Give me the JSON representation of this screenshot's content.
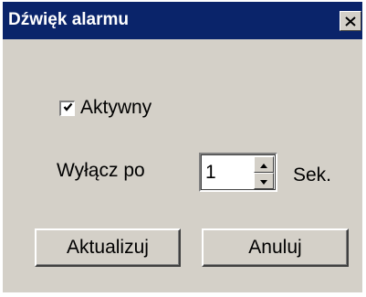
{
  "window": {
    "title": "Dźwięk alarmu",
    "close_icon": "close-icon"
  },
  "form": {
    "active_checkbox": {
      "label": "Aktywny",
      "checked": true
    },
    "turn_off_after": {
      "label": "Wyłącz po",
      "value": "1",
      "unit": "Sek."
    }
  },
  "buttons": {
    "update_label": "Aktualizuj",
    "cancel_label": "Anuluj"
  },
  "colors": {
    "titlebar": "#0a246a",
    "dialog_bg": "#d4d0c8"
  }
}
